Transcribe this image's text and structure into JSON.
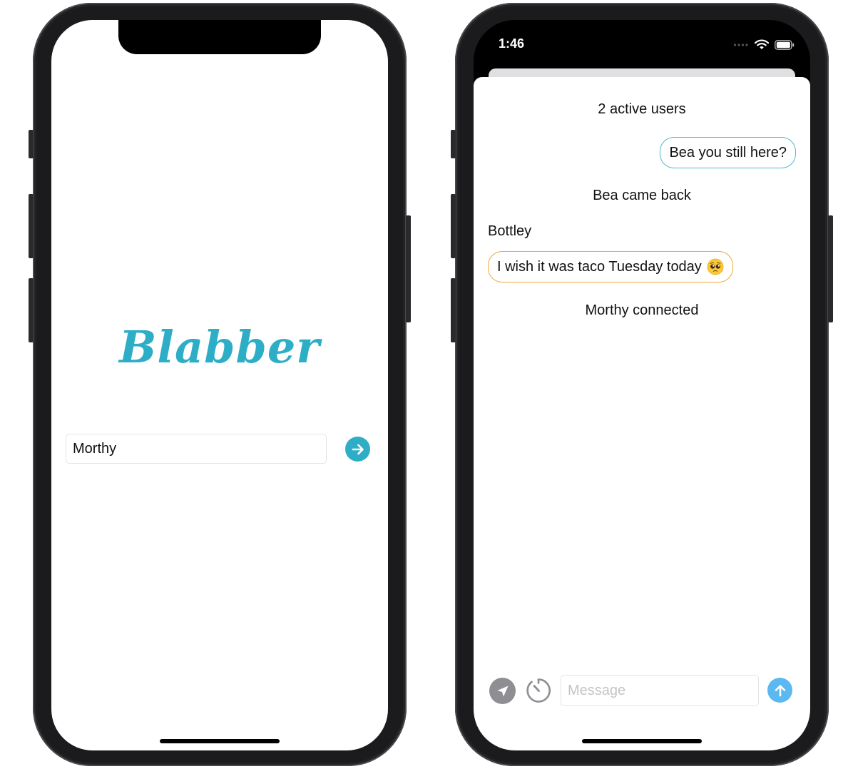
{
  "login": {
    "logo_text": "Blabber",
    "name_value": "Morthy",
    "submit_icon": "arrow-right-circle-icon"
  },
  "chat": {
    "status": {
      "time": "1:46",
      "icons": [
        "cellular-signal-icon",
        "wifi-icon",
        "battery-icon"
      ]
    },
    "active_users": "2 active users",
    "messages": [
      {
        "type": "own",
        "text": "Bea you still here?"
      },
      {
        "type": "system",
        "text": "Bea came back"
      },
      {
        "type": "other",
        "sender": "Bottley",
        "text": "I wish it was taco Tuesday today",
        "emoji": "pleading-face-emoji"
      },
      {
        "type": "system",
        "text": "Morthy connected"
      }
    ],
    "composer": {
      "placeholder": "Message",
      "location_icon": "location-arrow-icon",
      "timer_icon": "timer-icon",
      "send_icon": "arrow-up-circle-icon"
    }
  },
  "colors": {
    "brand": "#2eaec6",
    "own_bubble_border": "#52b9c7",
    "other_bubble_border": "#f2a73c",
    "send_button": "#5cb8f0",
    "location_button": "#8e8e93"
  }
}
